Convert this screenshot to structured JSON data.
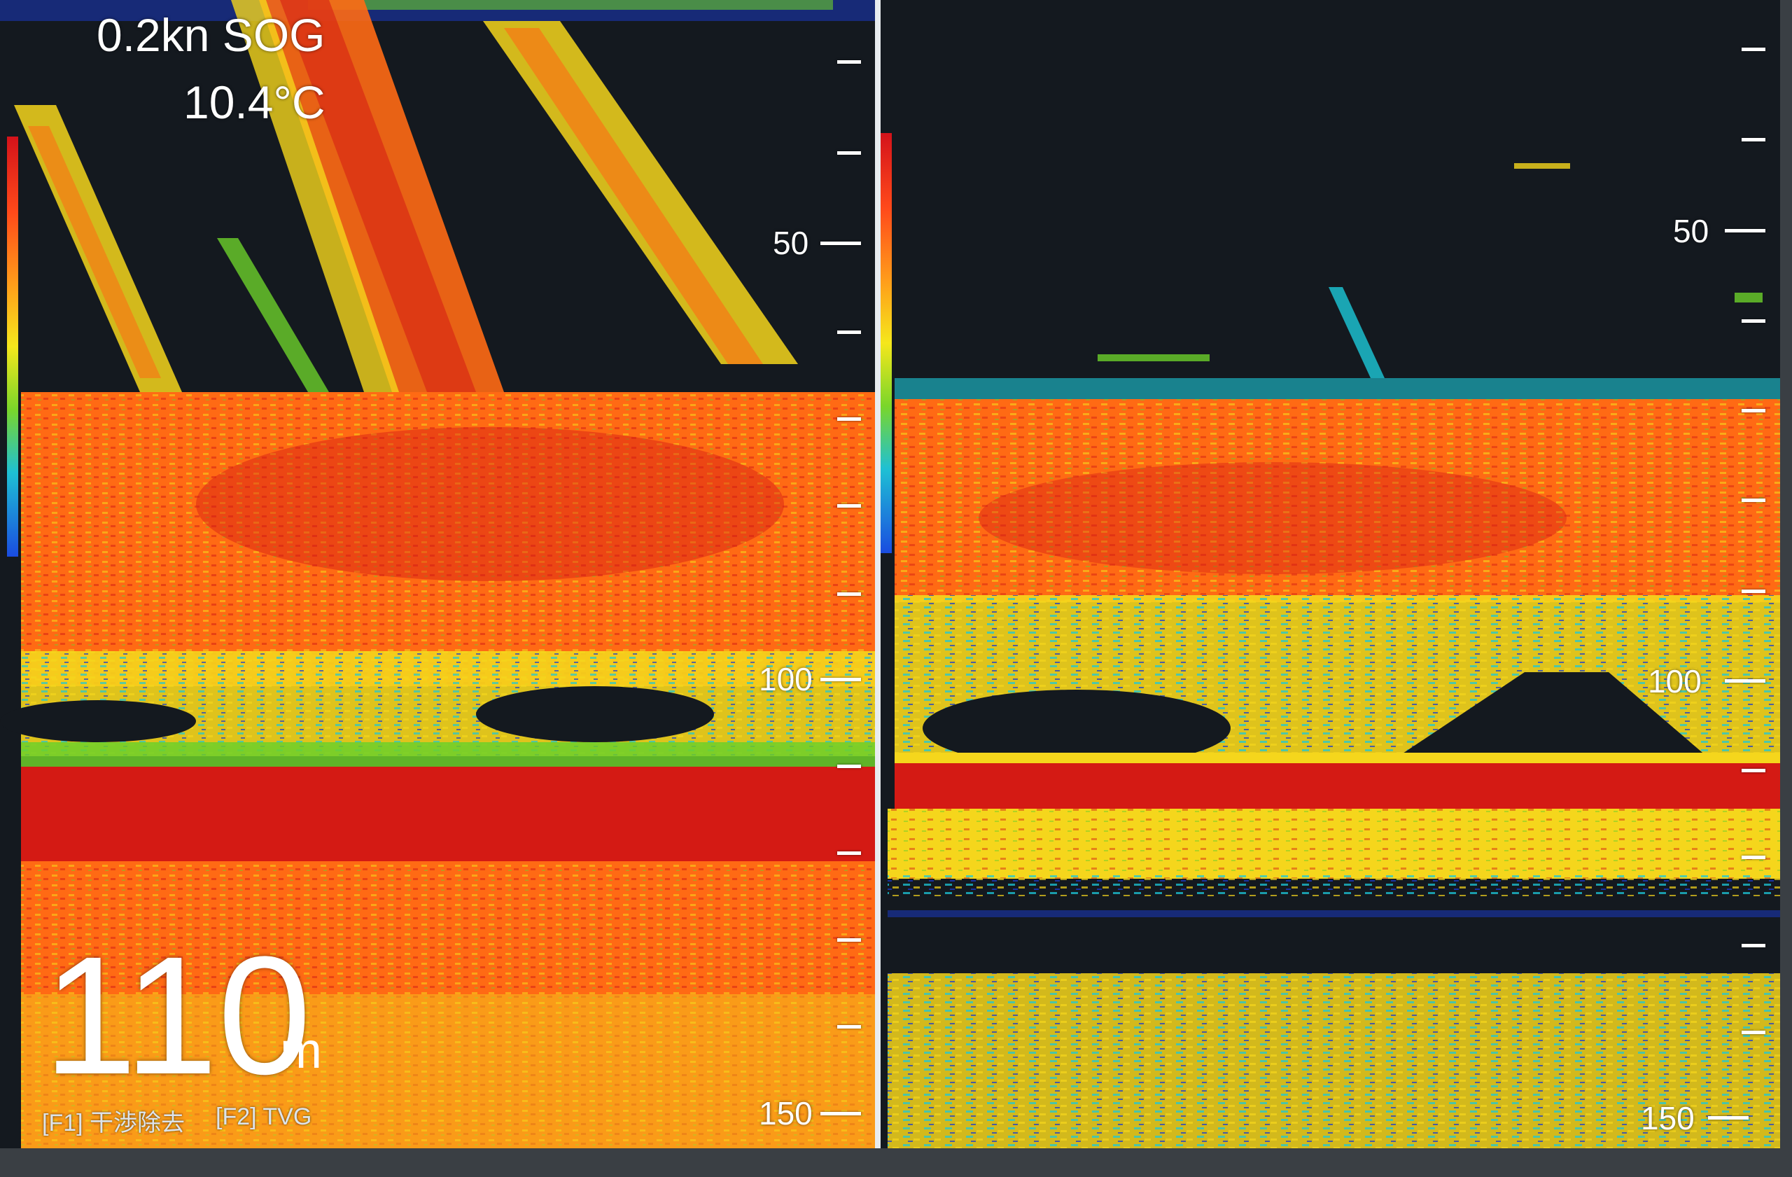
{
  "status": {
    "speed": "0.2kn SOG",
    "water_temp": "10.4°C"
  },
  "depth": {
    "value": "110",
    "unit": "m"
  },
  "function_keys": [
    {
      "label": "[F1] 干渉除去"
    },
    {
      "label": "[F2] TVG"
    }
  ],
  "left_scale": {
    "labels": [
      "50",
      "100",
      "150"
    ]
  },
  "right_scale": {
    "labels": [
      "50",
      "100",
      "150"
    ]
  },
  "colors": {
    "strong": "#d41a14",
    "orange": "#ff6a14",
    "yellow": "#f5d61c",
    "green": "#6cd02a",
    "cyan": "#1cc8d8",
    "blue": "#1a3ccf",
    "background": "#14191f"
  }
}
